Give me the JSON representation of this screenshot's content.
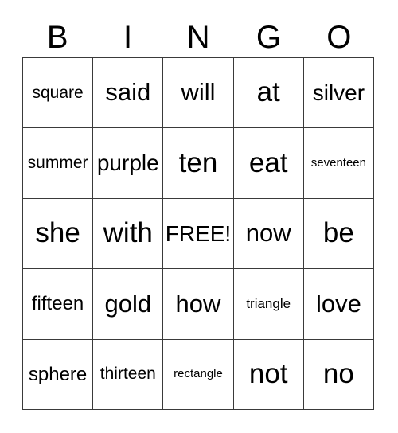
{
  "card": {
    "header": {
      "letters": [
        "B",
        "I",
        "N",
        "G",
        "O"
      ]
    },
    "columns": [
      "B",
      "I",
      "N",
      "G",
      "O"
    ],
    "rows": [
      [
        {
          "text": "square",
          "size": "xs"
        },
        {
          "text": "said",
          "size": "lg"
        },
        {
          "text": "will",
          "size": "lg"
        },
        {
          "text": "at",
          "size": "xl"
        },
        {
          "text": "silver",
          "size": "md"
        }
      ],
      [
        {
          "text": "summer",
          "size": "xs"
        },
        {
          "text": "purple",
          "size": "md"
        },
        {
          "text": "ten",
          "size": "xl"
        },
        {
          "text": "eat",
          "size": "xl"
        },
        {
          "text": "seventeen",
          "size": "tiny"
        }
      ],
      [
        {
          "text": "she",
          "size": "xl"
        },
        {
          "text": "with",
          "size": "xl"
        },
        {
          "text": "FREE!",
          "size": "md"
        },
        {
          "text": "now",
          "size": "lg"
        },
        {
          "text": "be",
          "size": "xl"
        }
      ],
      [
        {
          "text": "fifteen",
          "size": "sm"
        },
        {
          "text": "gold",
          "size": "lg"
        },
        {
          "text": "how",
          "size": "lg"
        },
        {
          "text": "triangle",
          "size": "xxs"
        },
        {
          "text": "love",
          "size": "lg"
        }
      ],
      [
        {
          "text": "sphere",
          "size": "sm"
        },
        {
          "text": "thirteen",
          "size": "xs"
        },
        {
          "text": "rectangle",
          "size": "tiny"
        },
        {
          "text": "not",
          "size": "xl"
        },
        {
          "text": "no",
          "size": "xl"
        }
      ]
    ],
    "free_space": "FREE!",
    "colors": {
      "background": "#ffffff",
      "border": "#3a3a3a",
      "text": "#000000"
    }
  }
}
